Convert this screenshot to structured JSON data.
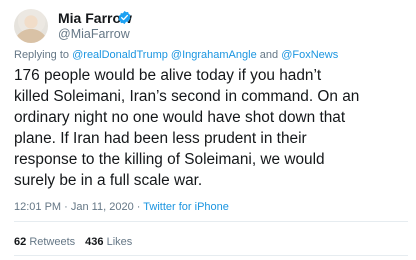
{
  "tweet": {
    "author": {
      "display_name": "Mia Farrow",
      "handle": "@MiaFarrow",
      "verified": true,
      "verified_color": "#1da1f2"
    },
    "reply": {
      "prefix": "Replying to",
      "mentions": [
        "@realDonaldTrump",
        "@IngrahamAngle"
      ],
      "conjunction": "and",
      "last_mention": "@FoxNews"
    },
    "text_lines": [
      "176 people would be alive today  if you hadn’t",
      "killed Soleimani, Iran’s second in command. On an",
      "ordinary night no one would have shot down that",
      "plane. If Iran had been less prudent in their",
      "response to the killing of Soleimani, we would",
      "surely be in a full scale war."
    ],
    "meta": {
      "time": "12:01 PM",
      "separator": "·",
      "date": "Jan 11, 2020",
      "source": "Twitter for iPhone"
    },
    "stats": {
      "retweets_count": "62",
      "retweets_label": "Retweets",
      "likes_count": "436",
      "likes_label": "Likes"
    }
  },
  "colors": {
    "link": "#1b95e0",
    "secondary_text": "#657786",
    "primary_text": "#14171a",
    "divider": "#e6ecf0"
  }
}
